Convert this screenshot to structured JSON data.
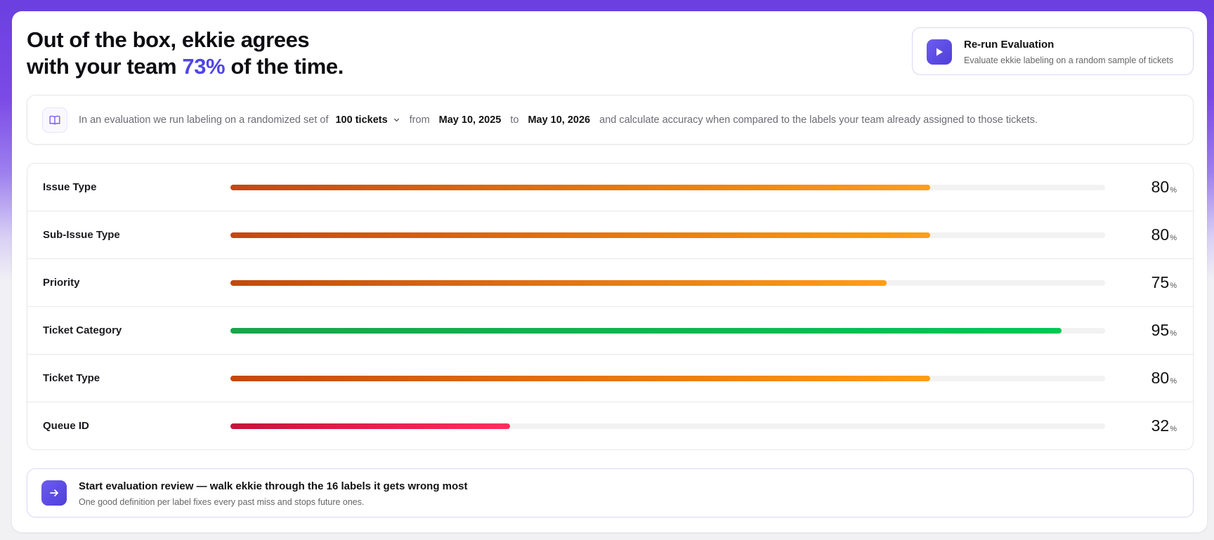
{
  "headline": {
    "line1": "Out of the box, ekkie agrees",
    "line2_prefix": "with your team ",
    "accent_value": "73%",
    "line2_suffix": " of the time."
  },
  "rerun": {
    "title": "Re-run Evaluation",
    "subtitle": "Evaluate ekkie labeling on a random sample of tickets",
    "icon": "play-icon"
  },
  "info": {
    "icon": "book-icon",
    "text_before": "In an evaluation we run labeling on a randomized set of",
    "sample_select": "100 tickets",
    "from_label": "from",
    "from_date": "May 10, 2025",
    "to_label": "to",
    "to_date": "May 10, 2026",
    "text_after": "and calculate accuracy when compared to the labels your team already assigned to those tickets."
  },
  "accuracy_rows": [
    {
      "label": "Issue Type",
      "value": "80",
      "unit": "%",
      "fraction": 0.8,
      "color": "orange"
    },
    {
      "label": "Sub-Issue Type",
      "value": "80",
      "unit": "%",
      "fraction": 0.8,
      "color": "orange"
    },
    {
      "label": "Priority",
      "value": "75",
      "unit": "%",
      "fraction": 0.75,
      "color": "orange"
    },
    {
      "label": "Ticket Category",
      "value": "95",
      "unit": "%",
      "fraction": 0.95,
      "color": "green"
    },
    {
      "label": "Ticket Type",
      "value": "80",
      "unit": "%",
      "fraction": 0.8,
      "color": "orange"
    },
    {
      "label": "Queue ID",
      "value": "32",
      "unit": "%",
      "fraction": 0.32,
      "color": "red"
    }
  ],
  "review": {
    "title": "Start evaluation review — walk ekkie through the 16 labels it gets wrong most",
    "subtitle": "One good definition per label fixes every past miss and stops future ones.",
    "icon": "arrow-right-icon"
  },
  "colors": {
    "accent": "#4f46e5",
    "orange_start": "#c3480f",
    "orange_end": "#ff9e16",
    "green": "#00c853",
    "red": "#ff2e5e"
  }
}
